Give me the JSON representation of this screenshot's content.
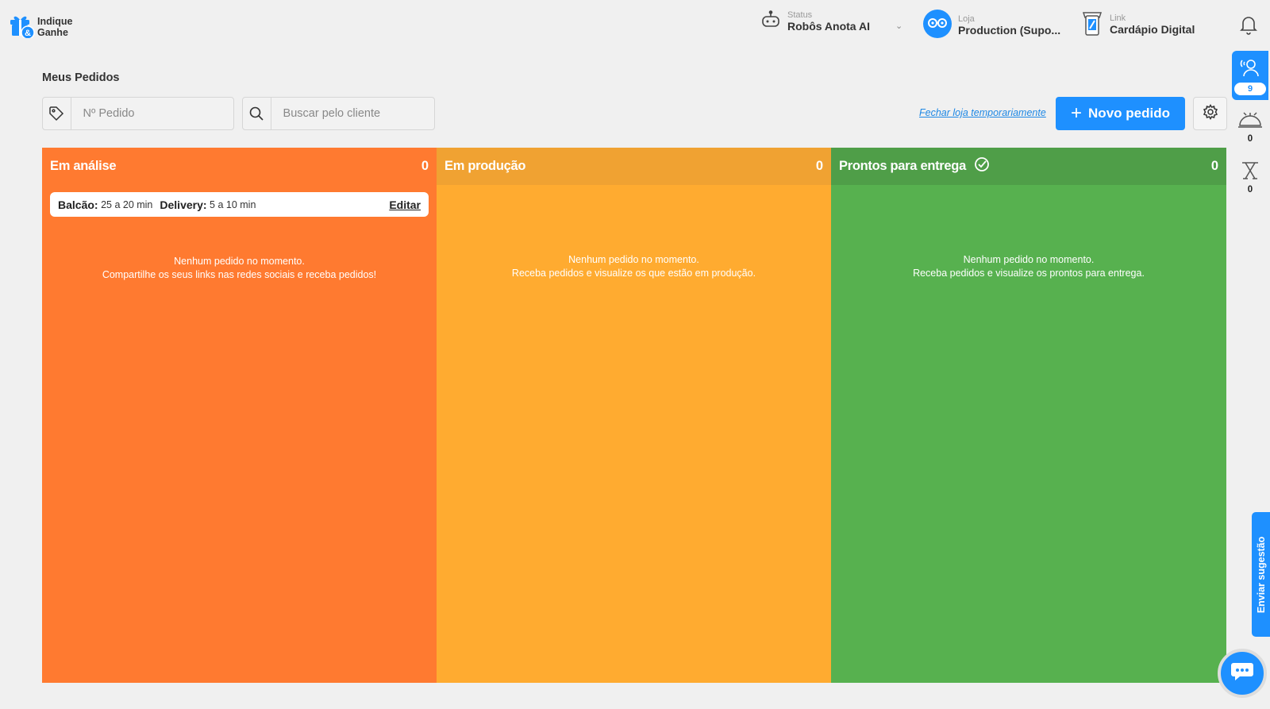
{
  "header": {
    "brand_line1": "Indique",
    "brand_line2": "Ganhe",
    "status_label": "Status",
    "status_value": "Robôs Anota AI",
    "store_label": "Loja",
    "store_value": "Production (Supo...",
    "link_label": "Link",
    "link_value": "Cardápio Digital"
  },
  "page": {
    "title": "Meus Pedidos",
    "order_placeholder": "Nº Pedido",
    "customer_placeholder": "Buscar pelo cliente",
    "close_store_link": "Fechar loja temporariamente",
    "new_order_label": "Novo pedido"
  },
  "columns": [
    {
      "title": "Em análise",
      "count": "0",
      "empty_line1": "Nenhum pedido no momento.",
      "empty_line2": "Compartilhe os seus links nas redes sociais e receba pedidos!"
    },
    {
      "title": "Em produção",
      "count": "0",
      "empty_line1": "Nenhum pedido no momento.",
      "empty_line2": "Receba pedidos e visualize os que estão em produção."
    },
    {
      "title": "Prontos para entrega",
      "count": "0",
      "empty_line1": "Nenhum pedido no momento.",
      "empty_line2": "Receba pedidos e visualize os prontos para entrega."
    }
  ],
  "times": {
    "counter_label": "Balcão:",
    "counter_value": "25 a 20 min",
    "delivery_label": "Delivery:",
    "delivery_value": "5 a 10 min",
    "edit_label": "Editar"
  },
  "rail": {
    "waiters_count": "9",
    "bell_count": "0",
    "table_count": "0"
  },
  "feedback_label": "Enviar sugestão",
  "colors": {
    "primary": "#1e90ff",
    "analysis": "#ff7a30",
    "production": "#ffab30",
    "ready": "#57b14f"
  }
}
